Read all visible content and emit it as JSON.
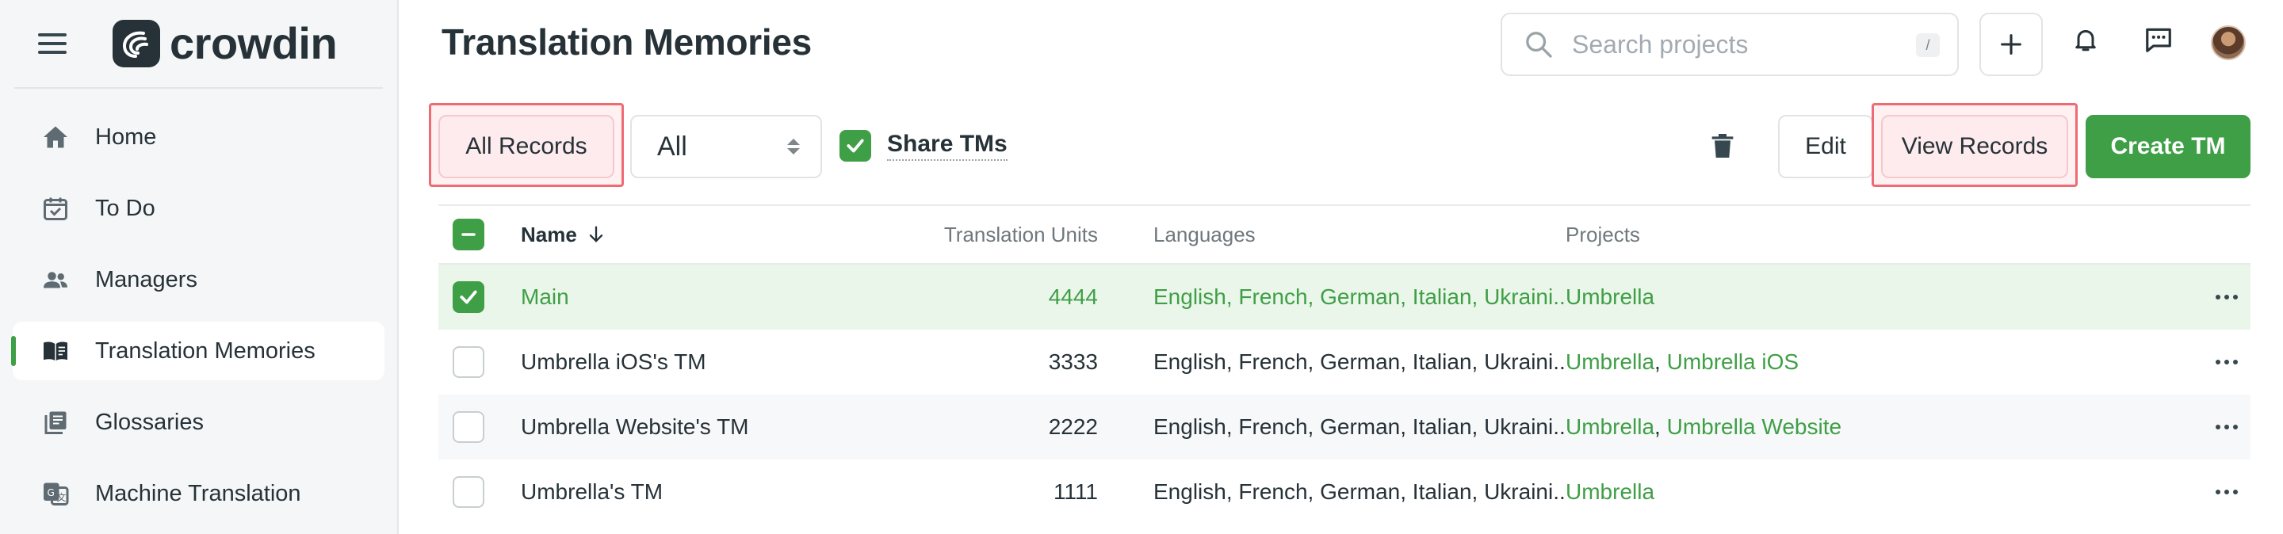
{
  "brand": {
    "name": "crowdin"
  },
  "sidebar": {
    "items": [
      {
        "label": "Home",
        "icon": "home-icon"
      },
      {
        "label": "To Do",
        "icon": "calendar-check-icon"
      },
      {
        "label": "Managers",
        "icon": "people-icon"
      },
      {
        "label": "Translation Memories",
        "icon": "open-book-icon",
        "active": true
      },
      {
        "label": "Glossaries",
        "icon": "glossary-icon"
      },
      {
        "label": "Machine Translation",
        "icon": "translate-icon"
      }
    ]
  },
  "header": {
    "title": "Translation Memories",
    "search": {
      "placeholder": "Search projects",
      "shortcut": "/"
    },
    "add_icon": "plus-icon",
    "notifications_icon": "bell-icon",
    "messages_icon": "chat-icon"
  },
  "toolbar": {
    "all_records_label": "All Records",
    "filter_value": "All",
    "share_tms_label": "Share TMs",
    "share_tms_checked": true,
    "edit_label": "Edit",
    "view_records_label": "View Records",
    "create_tm_label": "Create TM"
  },
  "table": {
    "columns": {
      "name": "Name",
      "units": "Translation Units",
      "languages": "Languages",
      "projects": "Projects"
    },
    "rows": [
      {
        "name": "Main",
        "units": "4444",
        "languages": "English, French, German, Italian, Ukraini...",
        "projects": [
          "Umbrella"
        ],
        "selected": true
      },
      {
        "name": "Umbrella iOS's TM",
        "units": "3333",
        "languages": "English, French, German, Italian, Ukraini...",
        "projects": [
          "Umbrella",
          "Umbrella iOS"
        ],
        "selected": false
      },
      {
        "name": "Umbrella Website's TM",
        "units": "2222",
        "languages": "English, French, German, Italian, Ukraini...",
        "projects": [
          "Umbrella",
          "Umbrella Website"
        ],
        "selected": false
      },
      {
        "name": "Umbrella's TM",
        "units": "1111",
        "languages": "English, French, German, Italian, Ukraini...",
        "projects": [
          "Umbrella"
        ],
        "selected": false
      }
    ]
  },
  "colors": {
    "accent": "#3f9f46",
    "highlight": "#ef6b74"
  }
}
